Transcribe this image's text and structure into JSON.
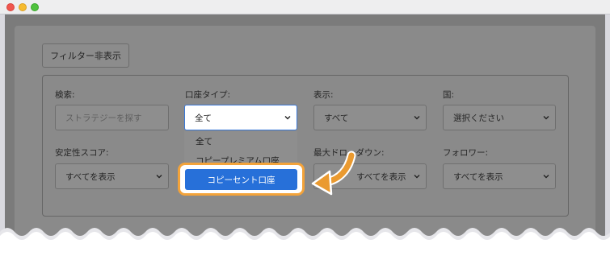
{
  "window": {
    "controls": [
      "close",
      "minimize",
      "zoom"
    ]
  },
  "filter_toggle_label": "フィルター非表示",
  "filters": {
    "search": {
      "label": "検索:",
      "placeholder": "ストラテジーを探す"
    },
    "account_type": {
      "label": "口座タイプ:",
      "value": "全て"
    },
    "display": {
      "label": "表示:",
      "value": "すべて"
    },
    "country": {
      "label": "国:",
      "value": "選択ください"
    },
    "stability_score": {
      "label": "安定性スコア:",
      "value": "すべてを表示"
    },
    "max_drawdown": {
      "label": "最大ドローダウン:",
      "value": "すべてを表示"
    },
    "followers": {
      "label": "フォロワー:",
      "value": "すべてを表示"
    }
  },
  "account_type_options": [
    "全て",
    "コピープレミアム口座",
    "コピーセント口座"
  ],
  "highlighted_option": "コピーセント口座",
  "colors": {
    "highlight_ring": "#f3a33a",
    "selected_option": "#2770d9",
    "overlay": "#8a8a8a"
  }
}
